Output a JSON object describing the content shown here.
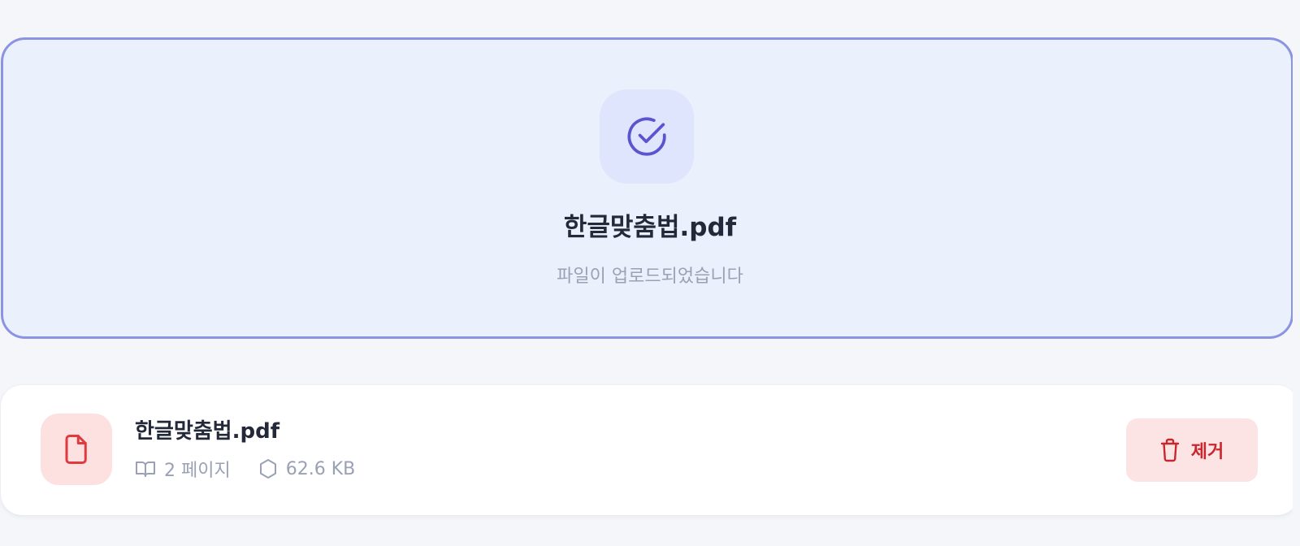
{
  "upload": {
    "filename": "한글맞춤법.pdf",
    "status": "파일이 업로드되었습니다",
    "icon": "check-circle-icon"
  },
  "file": {
    "name": "한글맞춤법.pdf",
    "pages": "2 페이지",
    "size": "62.6 KB",
    "file_icon": "file-icon",
    "pages_icon": "book-icon",
    "size_icon": "hexagon-icon",
    "remove_label": "제거",
    "remove_icon": "trash-icon"
  },
  "colors": {
    "accent": "#5a55cf",
    "dropzone_border": "#8b93e3",
    "dropzone_bg": "#ebf0fd",
    "danger": "#c8282d",
    "danger_bg": "#fde4e4"
  }
}
